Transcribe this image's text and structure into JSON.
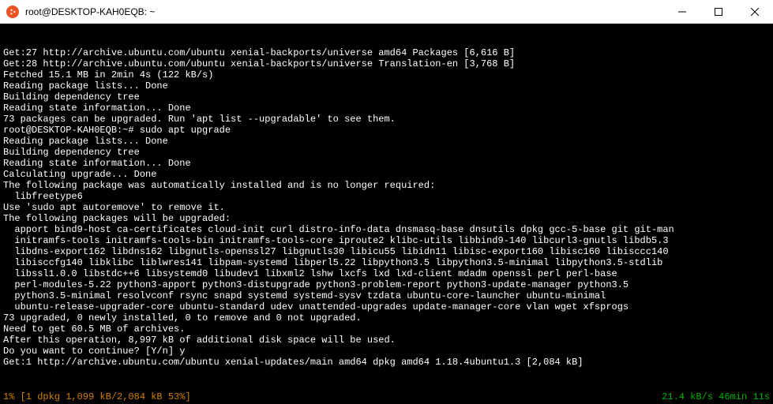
{
  "window": {
    "title": "root@DESKTOP-KAH0EQB: ~",
    "icon_semantic": "ubuntu-icon"
  },
  "terminal": {
    "lines": [
      "Get:27 http://archive.ubuntu.com/ubuntu xenial-backports/universe amd64 Packages [6,616 B]",
      "Get:28 http://archive.ubuntu.com/ubuntu xenial-backports/universe Translation-en [3,768 B]",
      "Fetched 15.1 MB in 2min 4s (122 kB/s)",
      "Reading package lists... Done",
      "Building dependency tree",
      "Reading state information... Done",
      "73 packages can be upgraded. Run 'apt list --upgradable' to see them.",
      "root@DESKTOP-KAH0EQB:~# sudo apt upgrade",
      "Reading package lists... Done",
      "Building dependency tree",
      "Reading state information... Done",
      "Calculating upgrade... Done",
      "The following package was automatically installed and is no longer required:",
      "  libfreetype6",
      "Use 'sudo apt autoremove' to remove it.",
      "The following packages will be upgraded:",
      "  apport bind9-host ca-certificates cloud-init curl distro-info-data dnsmasq-base dnsutils dpkg gcc-5-base git git-man",
      "  initramfs-tools initramfs-tools-bin initramfs-tools-core iproute2 klibc-utils libbind9-140 libcurl3-gnutls libdb5.3",
      "  libdns-export162 libdns162 libgnutls-openssl27 libgnutls30 libicu55 libidn11 libisc-export160 libisc160 libisccc140",
      "  libisccfg140 libklibc liblwres141 libpam-systemd libperl5.22 libpython3.5 libpython3.5-minimal libpython3.5-stdlib",
      "  libssl1.0.0 libstdc++6 libsystemd0 libudev1 libxml2 lshw lxcfs lxd lxd-client mdadm openssl perl perl-base",
      "  perl-modules-5.22 python3-apport python3-distupgrade python3-problem-report python3-update-manager python3.5",
      "  python3.5-minimal resolvconf rsync snapd systemd systemd-sysv tzdata ubuntu-core-launcher ubuntu-minimal",
      "  ubuntu-release-upgrader-core ubuntu-standard udev unattended-upgrades update-manager-core vlan wget xfsprogs",
      "73 upgraded, 0 newly installed, 0 to remove and 0 not upgraded.",
      "Need to get 60.5 MB of archives.",
      "After this operation, 8,997 kB of additional disk space will be used.",
      "Do you want to continue? [Y/n] y",
      "Get:1 http://archive.ubuntu.com/ubuntu xenial-updates/main amd64 dpkg amd64 1.18.4ubuntu1.3 [2,084 kB]"
    ],
    "status_left": "1% [1 dpkg 1,099 kB/2,084 kB 53%]",
    "status_right": "21.4 kB/s 46min 11s"
  }
}
